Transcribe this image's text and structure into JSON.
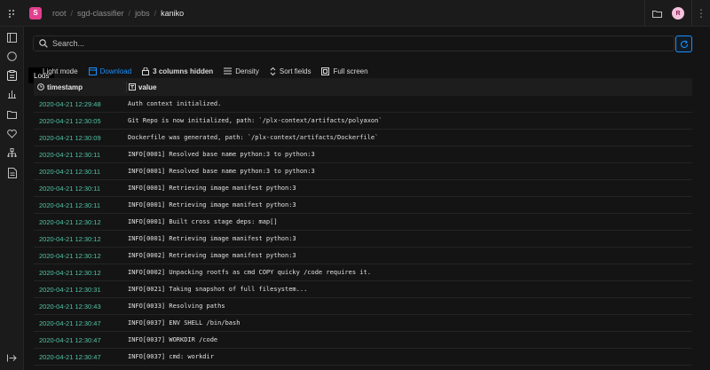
{
  "header": {
    "project_initial": "S",
    "breadcrumbs": [
      "root",
      "sgd-classifier",
      "jobs",
      "kaniko"
    ],
    "user_initial": "R"
  },
  "sidebar": {
    "items": [
      {
        "icon": "overview-icon"
      },
      {
        "icon": "status-icon"
      },
      {
        "icon": "logs-icon",
        "active": true
      },
      {
        "icon": "resources-icon"
      },
      {
        "icon": "artifacts-icon"
      },
      {
        "icon": "lineage-icon"
      },
      {
        "icon": "runs-graph-icon"
      },
      {
        "icon": "specification-icon"
      }
    ],
    "tooltip": "Logs"
  },
  "search": {
    "placeholder": "Search..."
  },
  "toolbar": {
    "light_mode": "Light mode",
    "download": "Download",
    "hidden_columns": "3 columns hidden",
    "density": "Density",
    "sort_fields": "Sort fields",
    "full_screen": "Full screen"
  },
  "table": {
    "columns": [
      "timestamp",
      "value"
    ],
    "rows": [
      {
        "timestamp": "2020-04-21 12:29:48",
        "value": "Auth context initialized."
      },
      {
        "timestamp": "2020-04-21 12:30:05",
        "value": "Git Repo is now initialized, path: `/plx-context/artifacts/polyaxon`"
      },
      {
        "timestamp": "2020-04-21 12:30:09",
        "value": "Dockerfile was generated, path: `/plx-context/artifacts/Dockerfile`"
      },
      {
        "timestamp": "2020-04-21 12:30:11",
        "value": "INFO[0001] Resolved base name python:3 to python:3"
      },
      {
        "timestamp": "2020-04-21 12:30:11",
        "value": "INFO[0001] Resolved base name python:3 to python:3"
      },
      {
        "timestamp": "2020-04-21 12:30:11",
        "value": "INFO[0001] Retrieving image manifest python:3"
      },
      {
        "timestamp": "2020-04-21 12:30:11",
        "value": "INFO[0001] Retrieving image manifest python:3"
      },
      {
        "timestamp": "2020-04-21 12:30:12",
        "value": "INFO[0001] Built cross stage deps: map[]"
      },
      {
        "timestamp": "2020-04-21 12:30:12",
        "value": "INFO[0001] Retrieving image manifest python:3"
      },
      {
        "timestamp": "2020-04-21 12:30:12",
        "value": "INFO[0002] Retrieving image manifest python:3"
      },
      {
        "timestamp": "2020-04-21 12:30:12",
        "value": "INFO[0002] Unpacking rootfs as cmd COPY quicky /code requires it."
      },
      {
        "timestamp": "2020-04-21 12:30:31",
        "value": "INFO[0021] Taking snapshot of full filesystem..."
      },
      {
        "timestamp": "2020-04-21 12:30:43",
        "value": "INFO[0033] Resolving paths"
      },
      {
        "timestamp": "2020-04-21 12:30:47",
        "value": "INFO[0037] ENV SHELL /bin/bash"
      },
      {
        "timestamp": "2020-04-21 12:30:47",
        "value": "INFO[0037] WORKDIR /code"
      },
      {
        "timestamp": "2020-04-21 12:30:47",
        "value": "INFO[0037] cmd: workdir"
      }
    ]
  },
  "colors": {
    "accent": "#1890ff",
    "timestamp": "#52c4a5",
    "project_badge": "#e33f8f"
  }
}
